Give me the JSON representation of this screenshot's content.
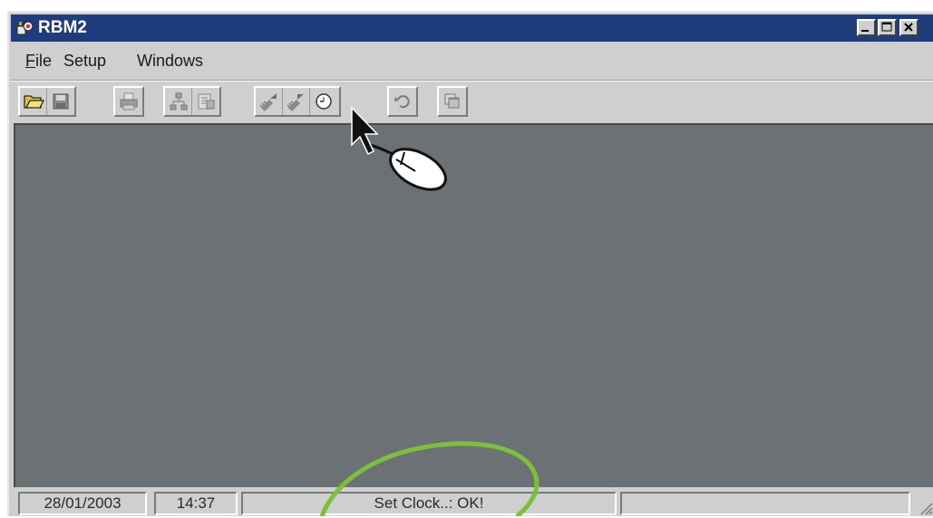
{
  "window": {
    "title": "RBM2",
    "title_icon": "app-icon",
    "controls": [
      "minimize-icon",
      "maximize-icon",
      "close-icon"
    ]
  },
  "menu": {
    "file": {
      "ul": "F",
      "rest": "ile"
    },
    "setup": "Setup",
    "windows": "Windows"
  },
  "toolbar": {
    "buttons": [
      "open-folder-icon",
      "save-icon",
      "print-icon",
      "network-icon",
      "properties-icon",
      "upload-chip-icon",
      "download-chip-icon",
      "clock-icon",
      "undo-icon",
      "cascade-windows-icon"
    ]
  },
  "status": {
    "date": "28/01/2003",
    "time": "14:37",
    "message": "Set Clock..: OK!",
    "extra": ""
  },
  "annotation": {
    "highlight_color": "#7cbf3b",
    "cursor": "arrow-cursor-icon",
    "mouse": "mouse-icon"
  }
}
